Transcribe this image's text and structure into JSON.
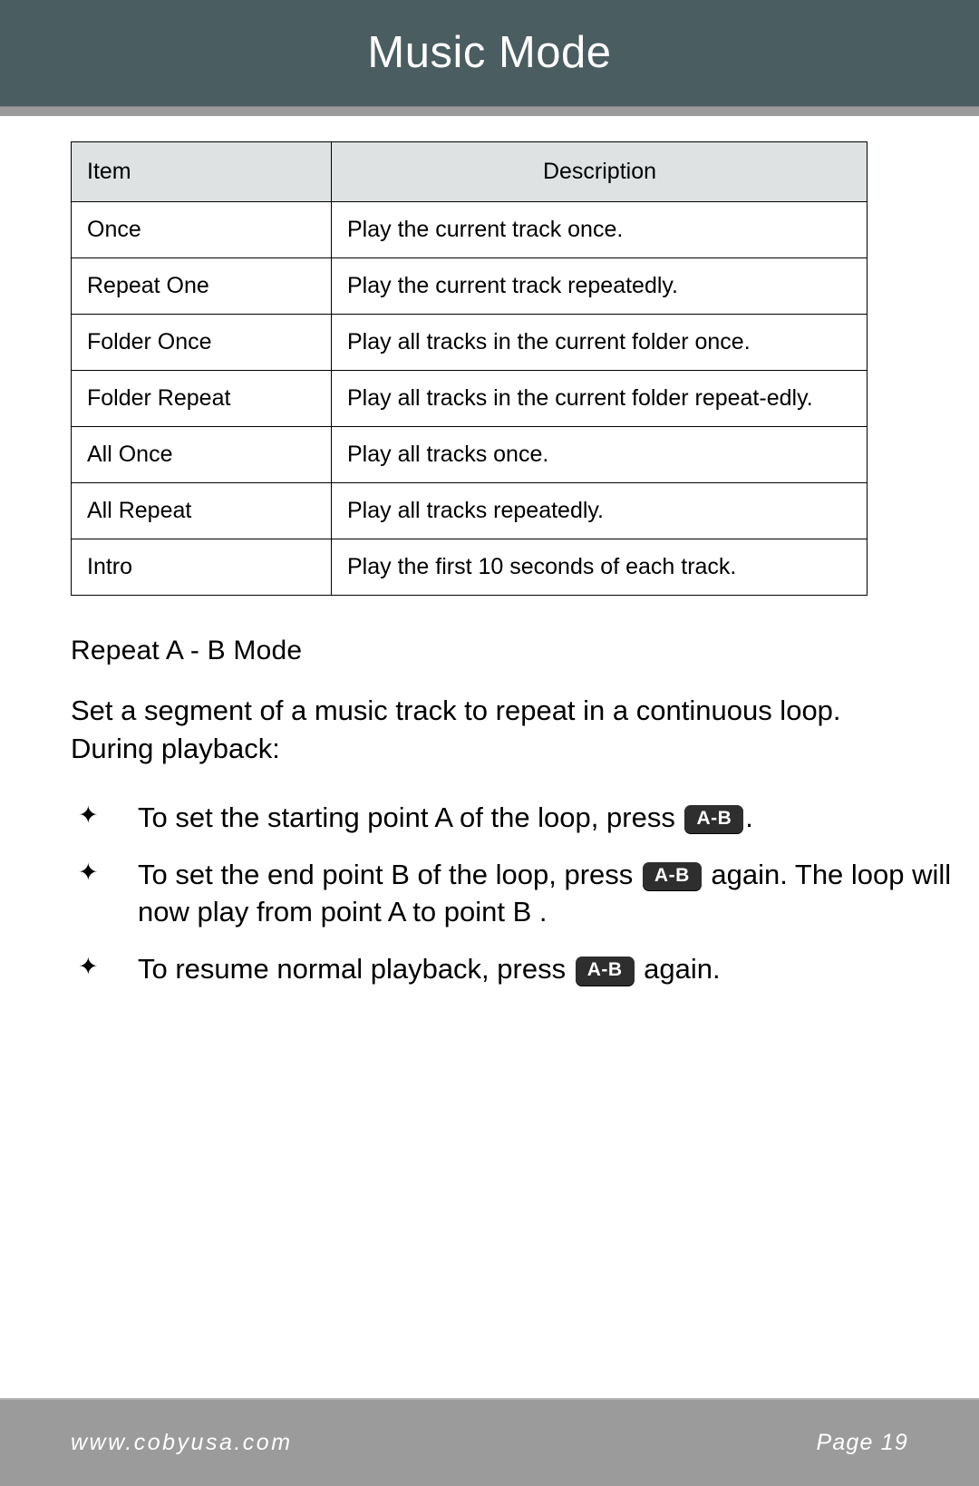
{
  "header": {
    "title": "Music Mode"
  },
  "table": {
    "columns": [
      "Item",
      "Description"
    ],
    "rows": [
      {
        "item": "Once",
        "description": "Play the current track once."
      },
      {
        "item": "Repeat One",
        "description": "Play the current track repeatedly."
      },
      {
        "item": "Folder Once",
        "description": "Play all tracks in the current folder once."
      },
      {
        "item": "Folder Repeat",
        "description": "Play all tracks in the current folder repeat-edly."
      },
      {
        "item": "All Once",
        "description": "Play all tracks once."
      },
      {
        "item": "All Repeat",
        "description": "Play all tracks repeatedly."
      },
      {
        "item": "Intro",
        "description": "Play the first 10 seconds of each track."
      }
    ]
  },
  "section": {
    "heading": "Repeat A - B Mode",
    "intro": "Set a segment of a music track to repeat in a continuous loop. During playback:",
    "bullet_marker": "✦",
    "key_label": "A-B",
    "bullets": [
      {
        "marker": "✦",
        "text_before": "To set the starting point  A  of the loop, press ",
        "key": "A-B",
        "text_after": "."
      },
      {
        "marker": "✦",
        "text_before": "To set the end point  B  of the loop, press ",
        "key": "A-B",
        "text_after": " again. The loop will now play from point  A  to point  B ."
      },
      {
        "marker": "✦",
        "text_before": "To resume normal playback, press ",
        "key": "A-B",
        "text_after": " again."
      }
    ]
  },
  "footer": {
    "url": "www.cobyusa.com",
    "page": "Page 19"
  },
  "colors": {
    "header_bg": "#4a5d61",
    "header_rule": "#9b9b9b",
    "table_header_bg": "#dee2e3",
    "footer_bg": "#9b9b9b",
    "key_bg": "#2e2e2e",
    "text": "#000000"
  }
}
